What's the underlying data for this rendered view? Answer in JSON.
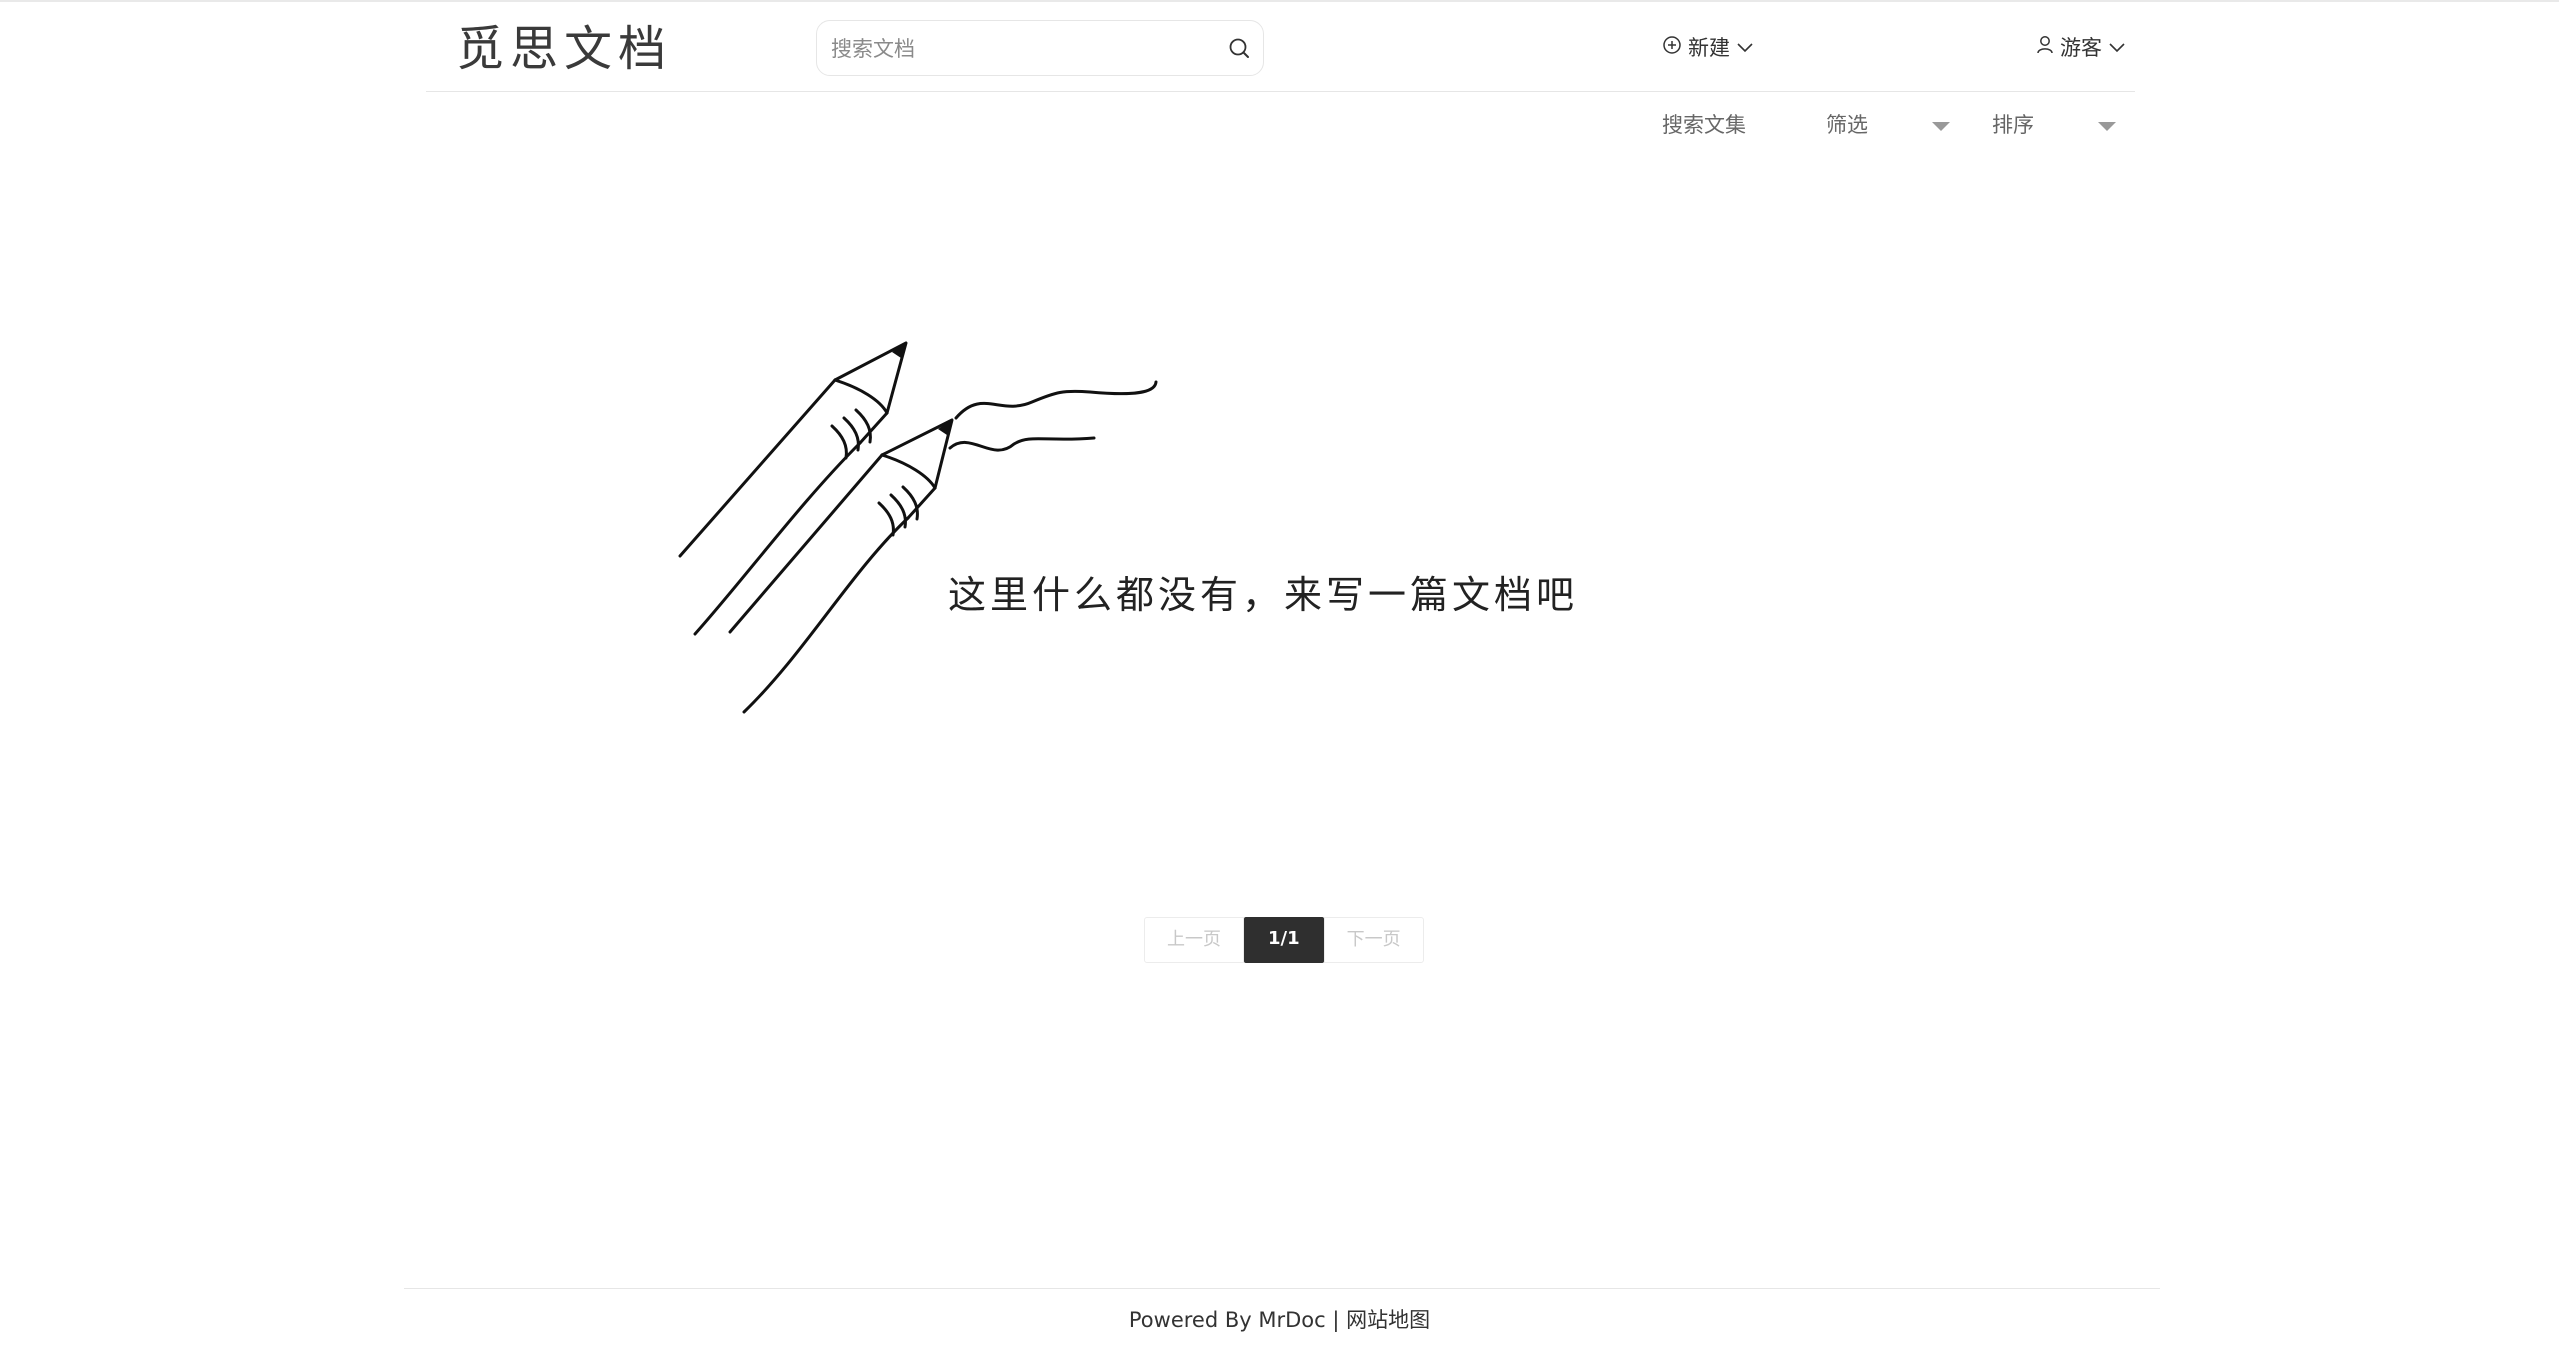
{
  "header": {
    "logo_text": "觅思文档",
    "search": {
      "placeholder": "搜索文档",
      "value": ""
    },
    "new_label": "新建",
    "user_label": "游客"
  },
  "filter_bar": {
    "search_collections_label": "搜索文集",
    "filter_label": "筛选",
    "sort_label": "排序"
  },
  "empty_state": {
    "message": "这里什么都没有，来写一篇文档吧"
  },
  "pagination": {
    "prev_label": "上一页",
    "current": "1/1",
    "next_label": "下一页"
  },
  "footer": {
    "powered_by": "Powered By MrDoc",
    "separator": "|",
    "sitemap_label": "网站地图"
  },
  "colors": {
    "accent": "#2f2f2f",
    "border": "#e6e6e6",
    "disabled_text": "#c8c8c8"
  },
  "icons": [
    "search-icon",
    "plus-circle-icon",
    "chevron-down-icon",
    "user-icon",
    "caret-down-icon",
    "pencils-illustration"
  ]
}
